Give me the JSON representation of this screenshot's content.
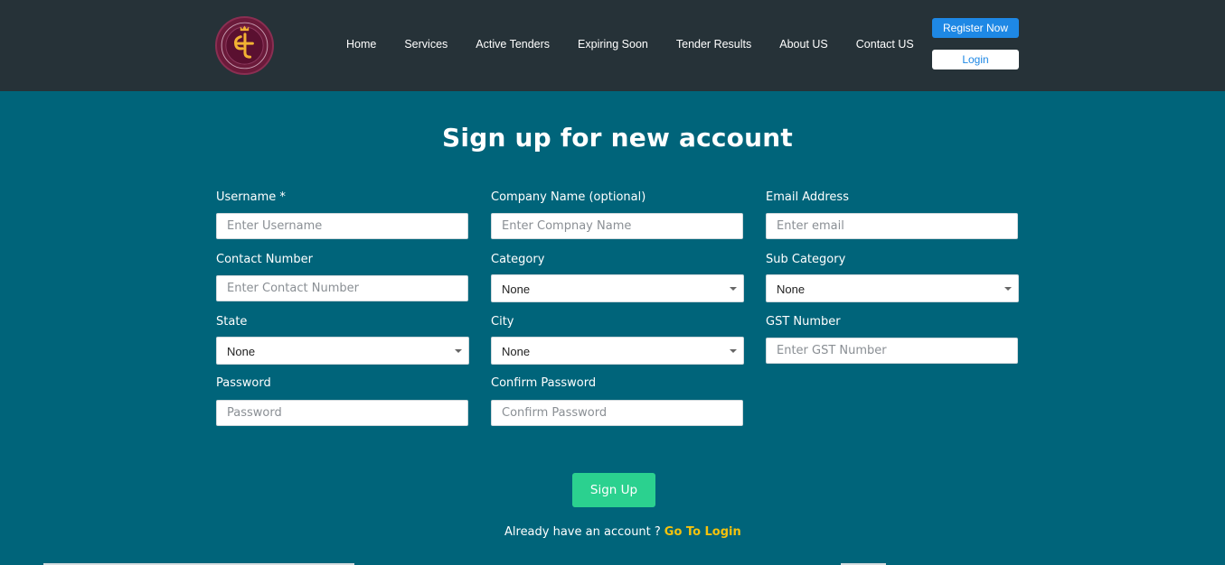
{
  "nav": {
    "links": [
      "Home",
      "Services",
      "Active Tenders",
      "Expiring Soon",
      "Tender Results",
      "About US",
      "Contact US"
    ],
    "register_label": "Register Now",
    "login_label": "Login"
  },
  "logo": {
    "icon": "tender-logo-icon",
    "colors": {
      "ring": "#6b1a3a",
      "glyph": "#f2b233"
    }
  },
  "form": {
    "title": "Sign up for new account",
    "fields": {
      "username": {
        "label": "Username *",
        "placeholder": "Enter Username"
      },
      "company": {
        "label": "Company Name (optional)",
        "placeholder": "Enter Compnay Name"
      },
      "email": {
        "label": "Email Address",
        "placeholder": "Enter email"
      },
      "contact": {
        "label": "Contact Number",
        "placeholder": "Enter Contact Number"
      },
      "category": {
        "label": "Category",
        "value": "None"
      },
      "subcategory": {
        "label": "Sub Category",
        "value": "None"
      },
      "state": {
        "label": "State",
        "value": "None"
      },
      "city": {
        "label": "City",
        "value": "None"
      },
      "gst": {
        "label": "GST Number",
        "placeholder": "Enter GST Number"
      },
      "password": {
        "label": "Password",
        "placeholder": "Password"
      },
      "confirm_password": {
        "label": "Confirm Password",
        "placeholder": "Confirm Password"
      }
    },
    "submit_label": "Sign Up",
    "footer_text": "Already have an account ?",
    "footer_link": "Go To Login"
  },
  "colors": {
    "navbar_bg": "#263238",
    "page_bg": "#00647a",
    "register_button": "#1e88e5",
    "signup_button": "#2bd18f",
    "login_link": "#f4c20d"
  }
}
